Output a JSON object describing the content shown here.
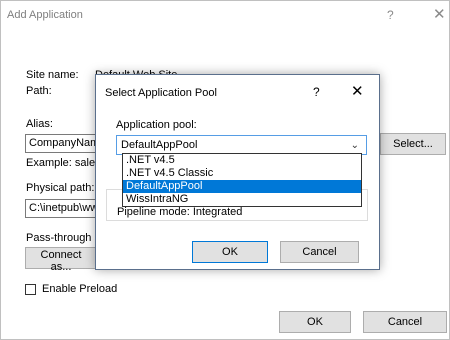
{
  "window": {
    "title": "Add Application",
    "help": "?",
    "close": "✕"
  },
  "site": {
    "name_label": "Site name:",
    "name_value": "Default Web Site",
    "path_label": "Path:"
  },
  "alias": {
    "label": "Alias:",
    "value": "CompanyNam",
    "example": "Example: sales"
  },
  "app_pool_section": {
    "select_button": "Select..."
  },
  "physical_path": {
    "label": "Physical path:",
    "value": "C:\\inetpub\\ww"
  },
  "pass_through": {
    "label": "Pass-through a",
    "connect_button": "Connect as..."
  },
  "preload": {
    "label": "Enable Preload"
  },
  "footer": {
    "ok": "OK",
    "cancel": "Cancel"
  },
  "pool_dialog": {
    "title": "Select Application Pool",
    "help": "?",
    "close": "✕",
    "field_label": "Application pool:",
    "selected": "DefaultAppPool",
    "options": [
      ".NET v4.5",
      ".NET v4.5 Classic",
      "DefaultAppPool",
      "WissIntraNG"
    ],
    "highlighted_index": 2,
    "pipeline_mode": "Pipeline mode: Integrated",
    "ok": "OK",
    "cancel": "Cancel"
  },
  "colors": {
    "accent": "#0078d7",
    "focus_border": "#569de5"
  }
}
